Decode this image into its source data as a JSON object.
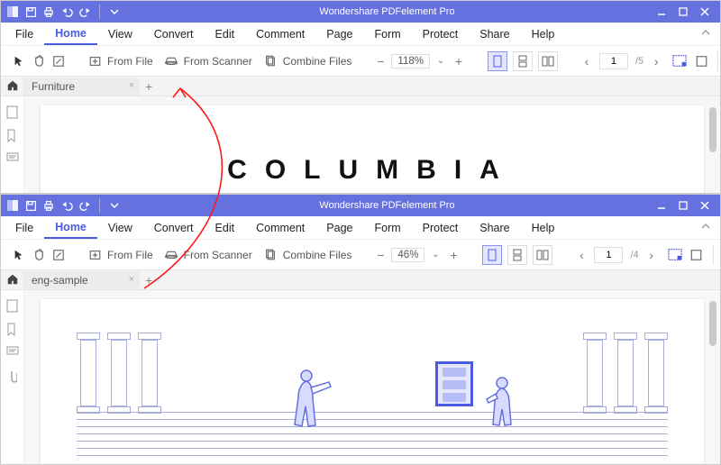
{
  "app_title": "Wondershare PDFelement Pro",
  "menus": {
    "file": "File",
    "home": "Home",
    "view": "View",
    "convert": "Convert",
    "edit": "Edit",
    "comment": "Comment",
    "page": "Page",
    "form": "Form",
    "protect": "Protect",
    "share": "Share",
    "help": "Help"
  },
  "toolbar": {
    "from_file": "From File",
    "from_scanner": "From Scanner",
    "combine_files": "Combine Files"
  },
  "window1": {
    "tab_name": "Furniture",
    "zoom": "118%",
    "page_current": "1",
    "page_total": "/5",
    "doc_heading": "COLUMBIA"
  },
  "window2": {
    "tab_name": "eng-sample",
    "zoom": "46%",
    "page_current": "1",
    "page_total": "/4"
  }
}
